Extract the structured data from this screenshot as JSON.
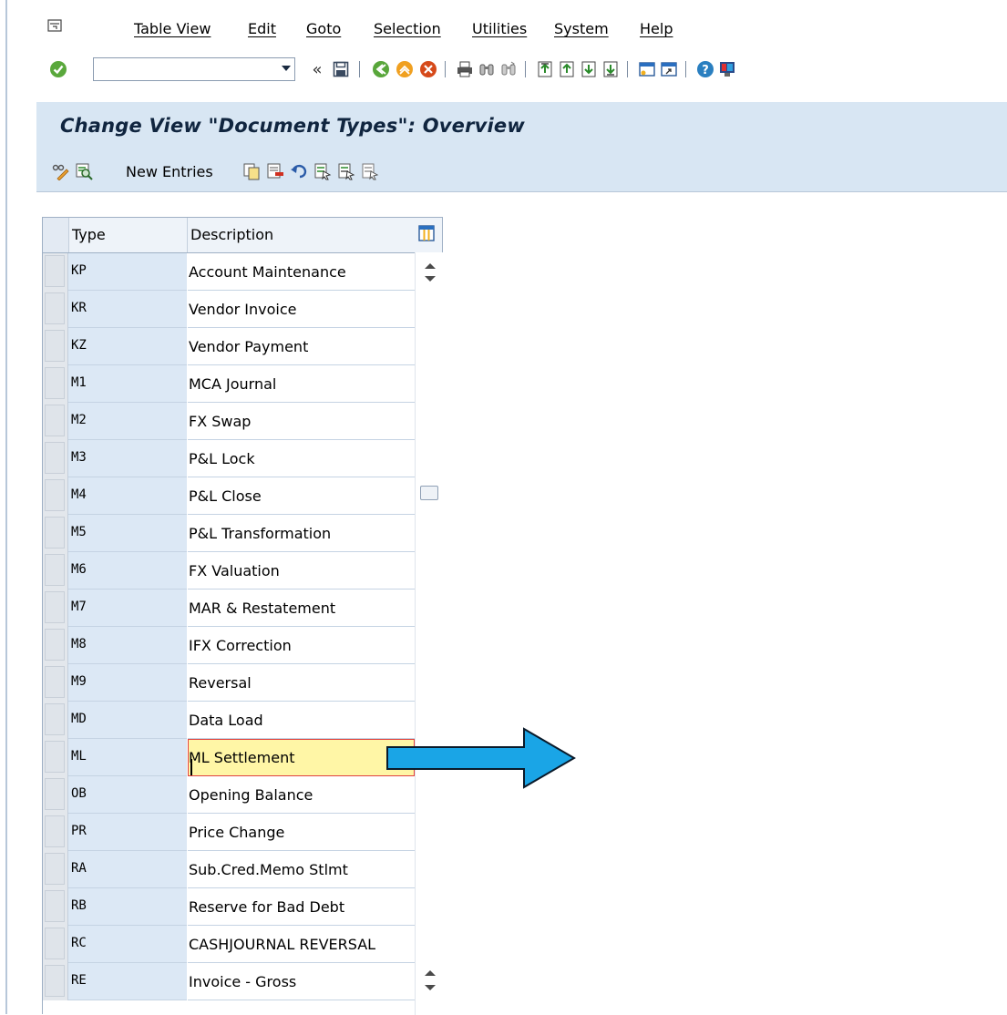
{
  "menu": {
    "items": [
      "Table View",
      "Edit",
      "Goto",
      "Selection",
      "Utilities",
      "System",
      "Help"
    ]
  },
  "toolbar": {
    "command_field_value": "",
    "icons": [
      "enter-icon",
      "dropdown-icon",
      "collapse-icon",
      "save-icon",
      "back-icon",
      "exit-icon",
      "cancel-icon",
      "print-icon",
      "find-icon",
      "find-next-icon",
      "first-page-icon",
      "previous-page-icon",
      "next-page-icon",
      "last-page-icon",
      "new-session-icon",
      "shortcut-icon",
      "help-icon",
      "layout-icon"
    ]
  },
  "page": {
    "title": "Change View \"Document Types\": Overview"
  },
  "app_toolbar": {
    "new_entries_label": "New Entries"
  },
  "table": {
    "headers": {
      "type": "Type",
      "description": "Description"
    },
    "rows": [
      {
        "type": "KP",
        "description": "Account Maintenance"
      },
      {
        "type": "KR",
        "description": "Vendor Invoice"
      },
      {
        "type": "KZ",
        "description": "Vendor Payment"
      },
      {
        "type": "M1",
        "description": "MCA Journal"
      },
      {
        "type": "M2",
        "description": "FX Swap"
      },
      {
        "type": "M3",
        "description": "P&L Lock"
      },
      {
        "type": "M4",
        "description": "P&L Close"
      },
      {
        "type": "M5",
        "description": "P&L Transformation"
      },
      {
        "type": "M6",
        "description": "FX Valuation"
      },
      {
        "type": "M7",
        "description": "MAR & Restatement"
      },
      {
        "type": "M8",
        "description": "IFX Correction"
      },
      {
        "type": "M9",
        "description": "Reversal"
      },
      {
        "type": "MD",
        "description": "Data Load"
      },
      {
        "type": "ML",
        "description": "ML Settlement"
      },
      {
        "type": "OB",
        "description": "Opening Balance"
      },
      {
        "type": "PR",
        "description": "Price Change"
      },
      {
        "type": "RA",
        "description": "Sub.Cred.Memo Stlmt"
      },
      {
        "type": "RB",
        "description": "Reserve for Bad Debt"
      },
      {
        "type": "RC",
        "description": "CASHJOURNAL REVERSAL"
      },
      {
        "type": "RE",
        "description": "Invoice - Gross"
      }
    ],
    "active_row": 13
  },
  "colors": {
    "title_bg": "#d8e6f3",
    "type_col_bg": "#dce8f5",
    "active_cell_bg": "#fff6a6",
    "annotation_arrow": "#1aa5e6"
  }
}
